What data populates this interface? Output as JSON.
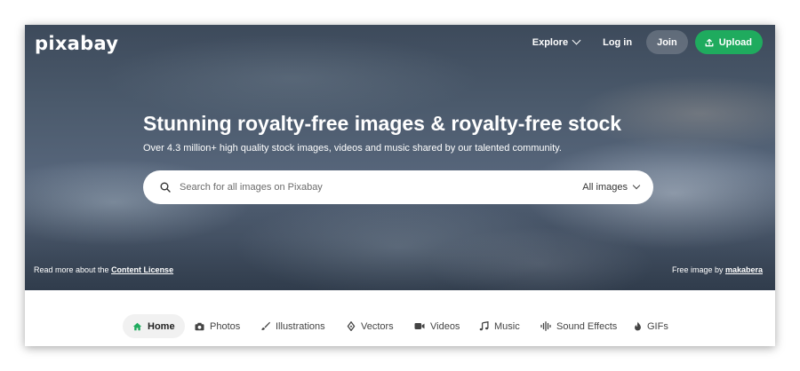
{
  "brand": {
    "logo": "pixabay",
    "accent": "#1fab5e"
  },
  "nav": {
    "explore": "Explore",
    "login": "Log in",
    "join": "Join",
    "upload": "Upload"
  },
  "hero": {
    "headline": "Stunning royalty-free images & royalty-free stock",
    "subline": "Over 4.3 million+ high quality stock images, videos and music shared by our talented community."
  },
  "search": {
    "placeholder": "Search for all images on Pixabay",
    "filter": "All images"
  },
  "footer": {
    "license_prefix": "Read more about the ",
    "license_link": "Content License",
    "credit_prefix": "Free image by ",
    "credit_link": "makabera"
  },
  "categories": [
    {
      "label": "Home",
      "icon": "home-icon",
      "active": true
    },
    {
      "label": "Photos",
      "icon": "camera-icon",
      "active": false
    },
    {
      "label": "Illustrations",
      "icon": "brush-icon",
      "active": false
    },
    {
      "label": "Vectors",
      "icon": "pen-nib-icon",
      "active": false
    },
    {
      "label": "Videos",
      "icon": "video-camera-icon",
      "active": false
    },
    {
      "label": "Music",
      "icon": "music-note-icon",
      "active": false
    },
    {
      "label": "Sound Effects",
      "icon": "sound-wave-icon",
      "active": false
    },
    {
      "label": "GIFs",
      "icon": "flame-icon",
      "active": false
    }
  ]
}
